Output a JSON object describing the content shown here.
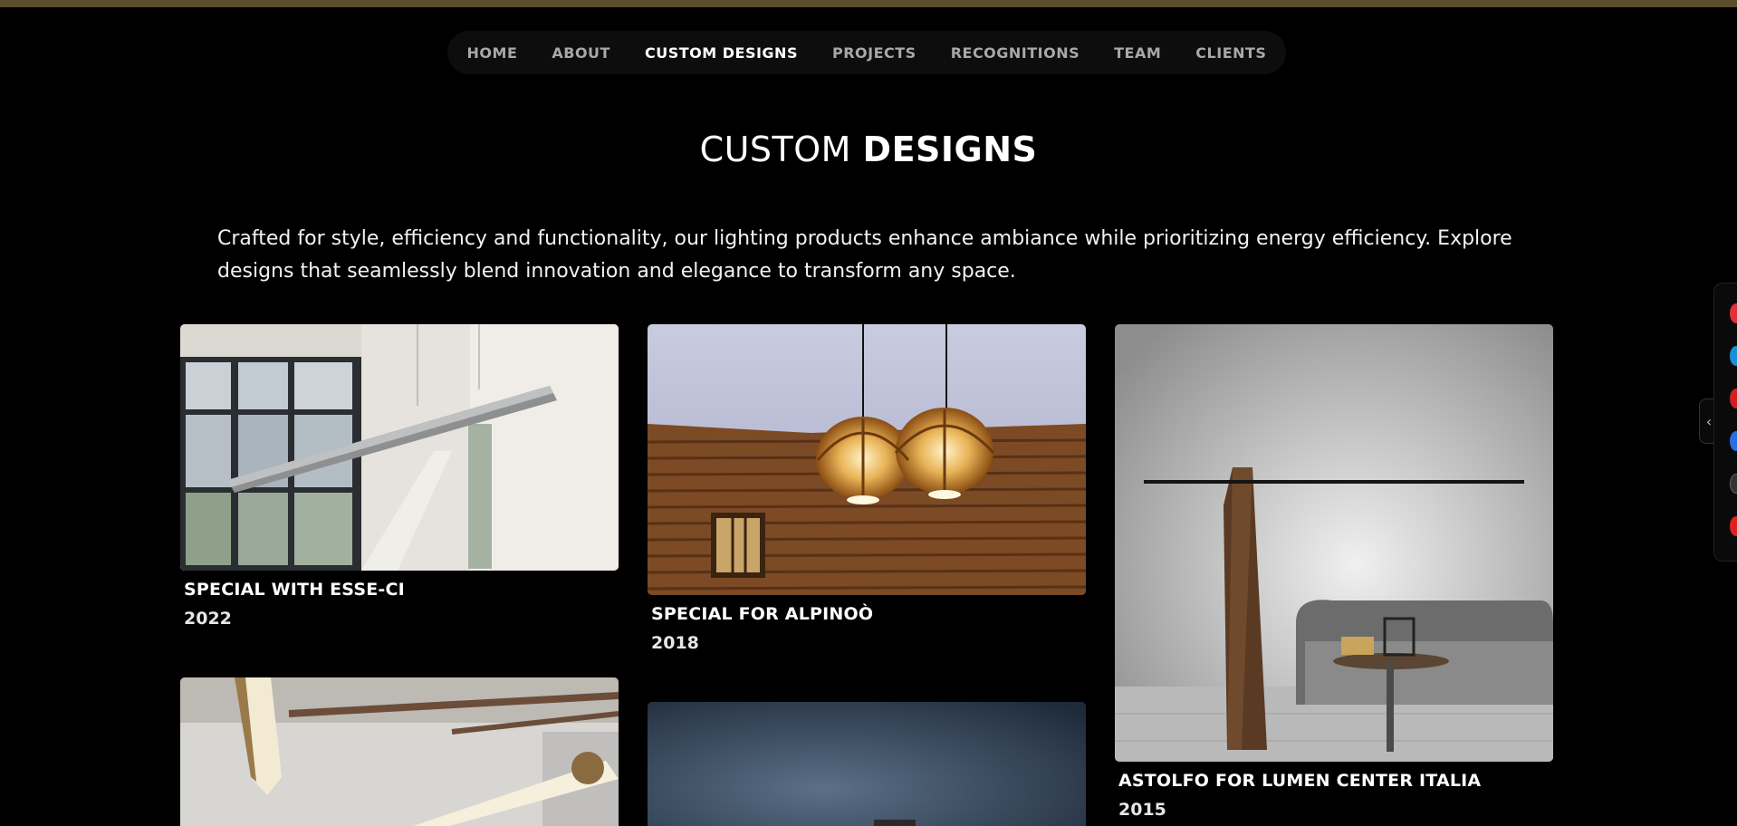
{
  "nav": {
    "items": [
      {
        "label": "HOME",
        "active": false
      },
      {
        "label": "ABOUT",
        "active": false
      },
      {
        "label": "CUSTOM DESIGNS",
        "active": true
      },
      {
        "label": "PROJECTS",
        "active": false
      },
      {
        "label": "RECOGNITIONS",
        "active": false
      },
      {
        "label": "TEAM",
        "active": false
      },
      {
        "label": "CLIENTS",
        "active": false
      }
    ]
  },
  "page": {
    "title_light": "CUSTOM",
    "title_bold": "DESIGNS",
    "intro": "Crafted for style, efficiency and functionality, our lighting products enhance ambiance while prioritizing energy efficiency. Explore designs that seamlessly blend innovation and elegance to transform any space."
  },
  "gallery": [
    {
      "title": "SPECIAL WITH ESSE-CI",
      "year": "2022",
      "image": "linear-pendant-lamp-office"
    },
    {
      "title": "SPECIAL FOR ALPINOÒ",
      "year": "2018",
      "image": "wooden-cage-pendant-lamps"
    },
    {
      "title": "ASTOLFO FOR LUMEN CENTER ITALIA",
      "year": "2015",
      "image": "wooden-floor-lamp-sofa"
    },
    {
      "title": "",
      "year": "",
      "image": "tube-pendant-lamps"
    },
    {
      "title": "",
      "year": "",
      "image": "dark-blue-lamp"
    }
  ],
  "side_widget": {
    "toggle_icon": "chevron-left-icon",
    "dot_colors": [
      "#e0303a",
      "#1a8fd6",
      "#d02020",
      "#2a6ee0",
      "#333333",
      "#e02020"
    ]
  },
  "colors": {
    "background": "#000000",
    "top_bar": "#5a4e2e",
    "nav_bg": "#0d0d0d"
  }
}
